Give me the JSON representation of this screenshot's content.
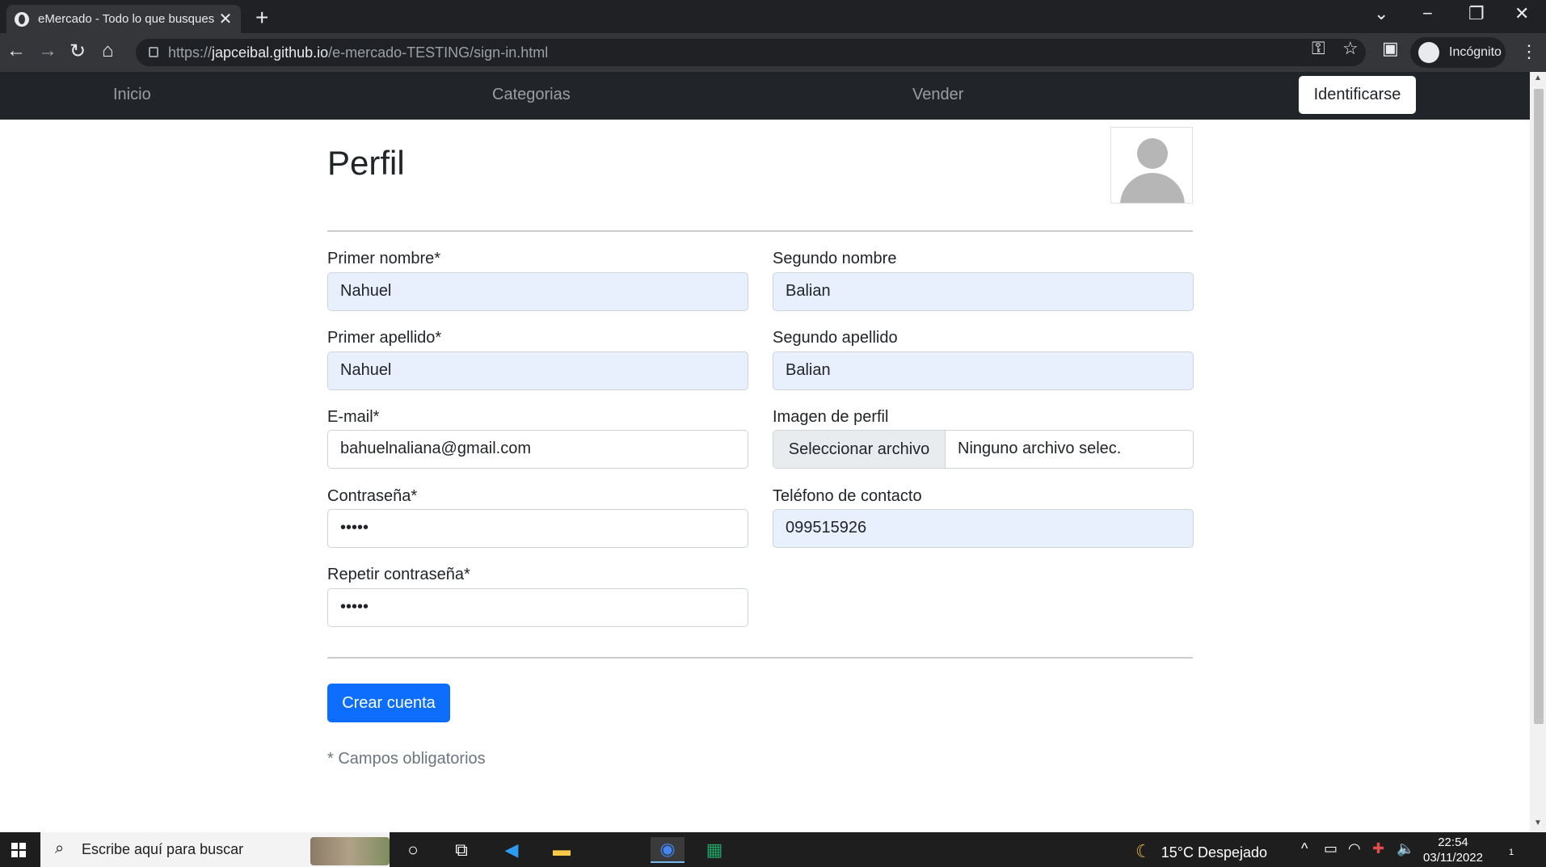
{
  "browser": {
    "tab_title": "eMercado - Todo lo que busques",
    "tab_close": "✕",
    "new_tab": "+",
    "url_prefix": "https://",
    "url_host": "japceibal.github.io",
    "url_path": "/e-mercado-TESTING/sign-in.html",
    "profile": "Incógnito"
  },
  "nav": {
    "items": [
      "Inicio",
      "Categorias",
      "Vender"
    ],
    "login_button": "Identificarse"
  },
  "form": {
    "title": "Perfil",
    "first_name_label": "Primer nombre*",
    "first_name_value": "Nahuel",
    "second_name_label": "Segundo nombre",
    "second_name_value": "Balian",
    "first_surname_label": "Primer apellido*",
    "first_surname_value": "Nahuel",
    "second_surname_label": "Segundo apellido",
    "second_surname_value": "Balian",
    "email_label": "E-mail*",
    "email_value": "bahuelnaliana@gmail.com",
    "image_label": "Imagen de perfil",
    "file_button": "Seleccionar archivo",
    "file_status": "Ninguno archivo selec.",
    "password_label": "Contraseña*",
    "password_value": "•••••",
    "phone_label": "Teléfono de contacto",
    "phone_value": "099515926",
    "repeat_password_label": "Repetir contraseña*",
    "repeat_password_value": "•••••",
    "submit_button": "Crear cuenta",
    "required_note": "* Campos obligatorios"
  },
  "taskbar": {
    "search_placeholder": "Escribe aquí para buscar",
    "weather": "15°C  Despejado",
    "time": "22:54",
    "date": "03/11/2022",
    "notification_count": "1"
  },
  "colors": {
    "navbar": "#212529",
    "primary": "#0d6efd",
    "autofill": "#e8f0fe"
  }
}
